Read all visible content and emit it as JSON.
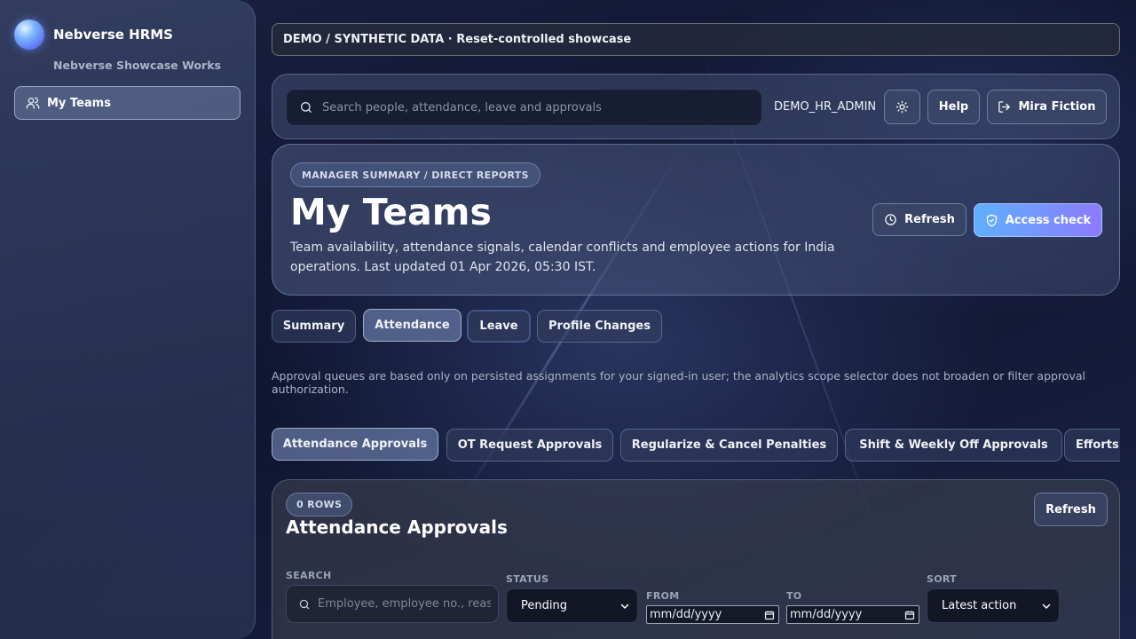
{
  "sidebar": {
    "brand_name": "Nebverse HRMS",
    "brand_sub": "Nebverse Showcase Works",
    "items": [
      {
        "label": "My Teams",
        "icon": "users-icon"
      }
    ]
  },
  "banner": {
    "text": "DEMO / SYNTHETIC DATA · Reset-controlled showcase"
  },
  "topbar": {
    "search_placeholder": "Search people, attendance, leave and approvals",
    "user_role": "DEMO_HR_ADMIN",
    "help_label": "Help",
    "user_name": "Mira Fiction"
  },
  "hero": {
    "chip": "MANAGER SUMMARY / DIRECT REPORTS",
    "title": "My Teams",
    "description": "Team availability, attendance signals, calendar conflicts and employee actions for India operations. Last updated 01 Apr 2026, 05:30 IST.",
    "refresh_label": "Refresh",
    "access_label": "Access check"
  },
  "tabs": [
    "Summary",
    "Attendance",
    "Leave",
    "Profile Changes"
  ],
  "active_tab": "Attendance",
  "note": "Approval queues are based only on persisted assignments for your signed-in user; the analytics scope selector does not broaden or filter approval authorization.",
  "subtabs": [
    "Attendance Approvals",
    "OT Request Approvals",
    "Regularize & Cancel Penalties",
    "Shift & Weekly Off Approvals",
    "Efforts"
  ],
  "active_subtab": "Attendance Approvals",
  "panel": {
    "rows_chip": "0 ROWS",
    "title": "Attendance Approvals",
    "refresh_label": "Refresh",
    "filters": {
      "search_label": "SEARCH",
      "search_placeholder": "Employee, employee no., reason",
      "status_label": "STATUS",
      "status_value": "Pending",
      "from_label": "FROM",
      "from_value": "mm/dd/yyyy",
      "to_label": "TO",
      "to_value": "mm/dd/yyyy",
      "sort_label": "SORT",
      "sort_value": "Latest action"
    }
  },
  "colors": {
    "accent_gradient_start": "#5fb0ff",
    "accent_gradient_end": "#8c7bff"
  }
}
